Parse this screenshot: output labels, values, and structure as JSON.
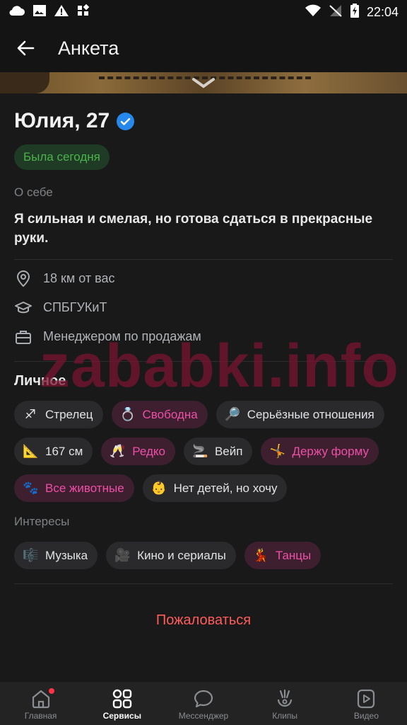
{
  "status_bar": {
    "time": "22:04"
  },
  "header": {
    "title": "Анкета"
  },
  "profile": {
    "name_age": "Юлия, 27",
    "online_status": "Была сегодня",
    "about_label": "О себе",
    "about_text": "Я сильная и смелая, но готова сдаться в прекрасные руки.",
    "info": [
      {
        "icon": "location-icon",
        "text": "18 км от вас"
      },
      {
        "icon": "education-icon",
        "text": "СПБГУКиТ"
      },
      {
        "icon": "briefcase-icon",
        "text": "Менеджером по продажам"
      }
    ]
  },
  "personal": {
    "heading": "Личное",
    "chips": [
      {
        "emoji": "♐",
        "text": "Стрелец",
        "highlight": false
      },
      {
        "emoji": "💍",
        "text": "Свободна",
        "highlight": true
      },
      {
        "emoji": "🔎",
        "text": "Серьёзные отношения",
        "highlight": false
      },
      {
        "emoji": "📐",
        "text": "167 см",
        "highlight": false
      },
      {
        "emoji": "🥂",
        "text": "Редко",
        "highlight": true
      },
      {
        "emoji": "🚬",
        "text": "Вейп",
        "highlight": false
      },
      {
        "emoji": "🤸",
        "text": "Держу форму",
        "highlight": true
      },
      {
        "emoji": "🐾",
        "text": "Все животные",
        "highlight": true
      },
      {
        "emoji": "👶",
        "text": "Нет детей, но хочу",
        "highlight": false
      }
    ]
  },
  "interests": {
    "label": "Интересы",
    "chips": [
      {
        "emoji": "🎼",
        "text": "Музыка",
        "highlight": false
      },
      {
        "emoji": "🎥",
        "text": "Кино и сериалы",
        "highlight": false
      },
      {
        "emoji": "💃",
        "text": "Танцы",
        "highlight": true
      }
    ]
  },
  "report_label": "Пожаловаться",
  "watermark": "zababki.info",
  "tabbar": {
    "items": [
      {
        "label": "Главная",
        "icon": "home-icon",
        "active": false,
        "badge": true
      },
      {
        "label": "Сервисы",
        "icon": "services-icon",
        "active": true,
        "badge": false
      },
      {
        "label": "Мессенджер",
        "icon": "messenger-icon",
        "active": false,
        "badge": false
      },
      {
        "label": "Клипы",
        "icon": "clips-icon",
        "active": false,
        "badge": false
      },
      {
        "label": "Видео",
        "icon": "video-icon",
        "active": false,
        "badge": false
      }
    ]
  },
  "colors": {
    "accent_green": "#4bb34b",
    "accent_pink": "#ee4fa7",
    "report_red": "#ff5c5c",
    "verified_blue": "#2688eb"
  }
}
